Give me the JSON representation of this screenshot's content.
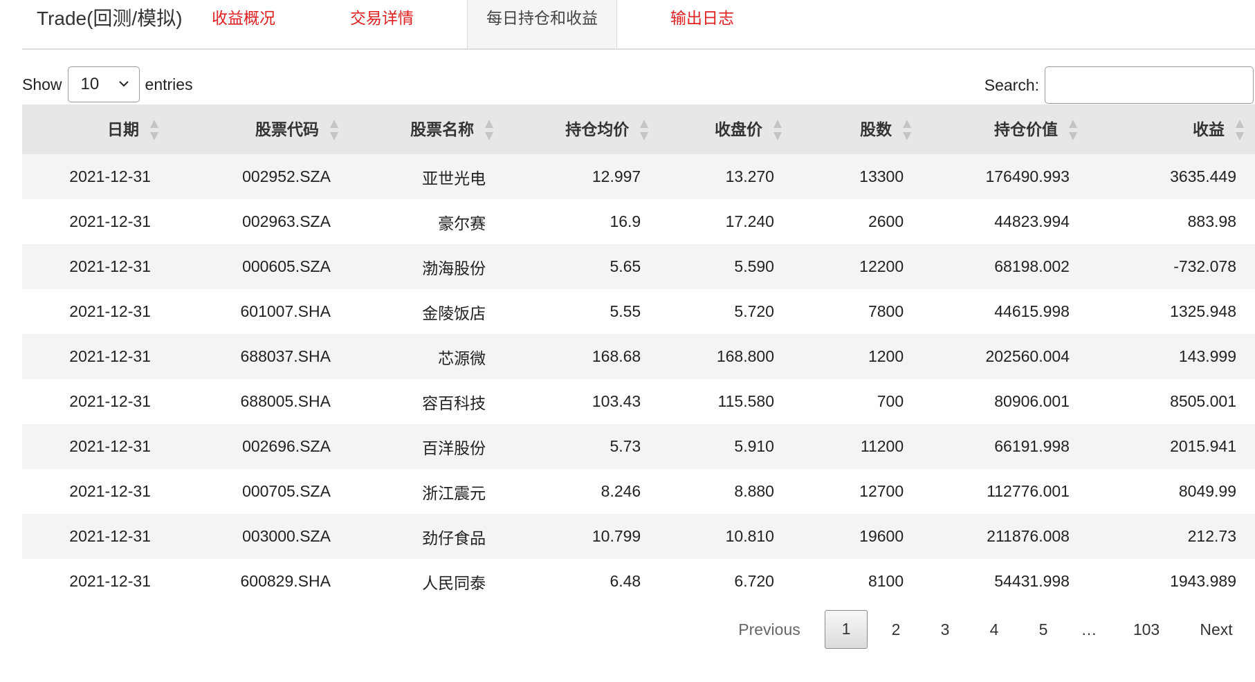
{
  "nav": {
    "brand": "Trade(回测/模拟)",
    "tabs": [
      {
        "label": "收益概况",
        "active": false
      },
      {
        "label": "交易详情",
        "active": false
      },
      {
        "label": "每日持仓和收益",
        "active": true
      },
      {
        "label": "输出日志",
        "active": false
      }
    ]
  },
  "controls": {
    "show_label": "Show",
    "page_length": "10",
    "entries_label": "entries",
    "search_label": "Search:",
    "search_value": ""
  },
  "table": {
    "columns": [
      "日期",
      "股票代码",
      "股票名称",
      "持仓均价",
      "收盘价",
      "股数",
      "持仓价值",
      "收益"
    ],
    "rows": [
      [
        "2021-12-31",
        "002952.SZA",
        "亚世光电",
        "12.997",
        "13.270",
        "13300",
        "176490.993",
        "3635.449"
      ],
      [
        "2021-12-31",
        "002963.SZA",
        "豪尔赛",
        "16.9",
        "17.240",
        "2600",
        "44823.994",
        "883.98"
      ],
      [
        "2021-12-31",
        "000605.SZA",
        "渤海股份",
        "5.65",
        "5.590",
        "12200",
        "68198.002",
        "-732.078"
      ],
      [
        "2021-12-31",
        "601007.SHA",
        "金陵饭店",
        "5.55",
        "5.720",
        "7800",
        "44615.998",
        "1325.948"
      ],
      [
        "2021-12-31",
        "688037.SHA",
        "芯源微",
        "168.68",
        "168.800",
        "1200",
        "202560.004",
        "143.999"
      ],
      [
        "2021-12-31",
        "688005.SHA",
        "容百科技",
        "103.43",
        "115.580",
        "700",
        "80906.001",
        "8505.001"
      ],
      [
        "2021-12-31",
        "002696.SZA",
        "百洋股份",
        "5.73",
        "5.910",
        "11200",
        "66191.998",
        "2015.941"
      ],
      [
        "2021-12-31",
        "000705.SZA",
        "浙江震元",
        "8.246",
        "8.880",
        "12700",
        "112776.001",
        "8049.99"
      ],
      [
        "2021-12-31",
        "003000.SZA",
        "劲仔食品",
        "10.799",
        "10.810",
        "19600",
        "211876.008",
        "212.73"
      ],
      [
        "2021-12-31",
        "600829.SHA",
        "人民同泰",
        "6.48",
        "6.720",
        "8100",
        "54431.998",
        "1943.989"
      ]
    ]
  },
  "pagination": {
    "previous": "Previous",
    "pages": [
      "1",
      "2",
      "3",
      "4",
      "5"
    ],
    "current": "1",
    "ellipsis": "…",
    "last": "103",
    "next": "Next"
  },
  "colors": {
    "tab_link": "#e02020",
    "header_bg": "#e6e7e9",
    "row_stripe": "#f4f4f4",
    "active_tab_bg": "#f4f5f7"
  },
  "icons": {
    "sort": "sort-both-icon",
    "select": "chevron-down-icon"
  }
}
